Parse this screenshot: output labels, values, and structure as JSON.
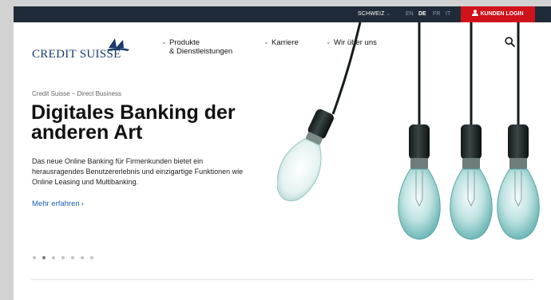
{
  "topbar": {
    "region": "SCHWEIZ",
    "languages": [
      "EN",
      "DE",
      "FR",
      "IT"
    ],
    "active_language": "DE",
    "login_label": "KUNDEN LOGIN"
  },
  "brand": {
    "logo_text": "CREDIT SUISSE"
  },
  "nav": {
    "items": [
      {
        "line1": "Produkte",
        "line2": "& Dienstleistungen"
      },
      {
        "line1": "Karriere",
        "line2": ""
      },
      {
        "line1": "Wir über uns",
        "line2": ""
      }
    ]
  },
  "hero": {
    "kicker": "Credit Suisse – Direct Business",
    "title": "Digitales Banking der anderen Art",
    "description": "Das neue Online Banking für Firmenkunden bietet ein herausragendes Benutzererlebnis und einzigartige Funktionen wie Online Leasing und Multibanking.",
    "link": "Mehr erfahren",
    "link_arrow": "›"
  },
  "carousel": {
    "count": 7,
    "active_index": 1
  },
  "colors": {
    "topbar": "#1f2b38",
    "accent_red": "#d0121b",
    "brand_blue": "#1b3a6b",
    "link_blue": "#1a5fb4"
  }
}
